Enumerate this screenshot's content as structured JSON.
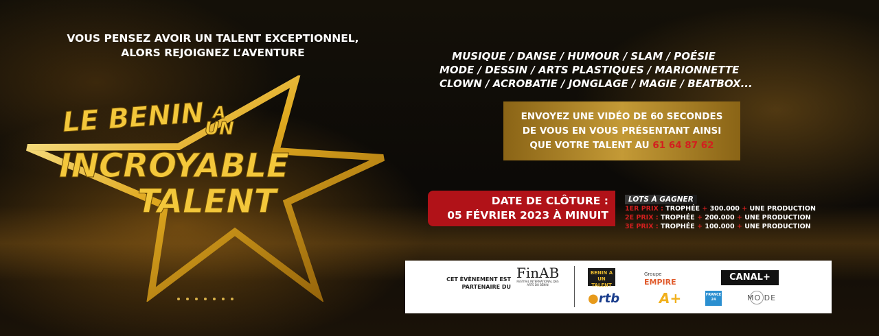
{
  "headline": {
    "line1": "VOUS PENSEZ AVOIR UN TALENT EXCEPTIONNEL,",
    "line2": "ALORS REJOIGNEZ L’AVENTURE"
  },
  "logo": {
    "word1": "LE BENIN",
    "word2": "A",
    "word3": "UN",
    "word4": "INCROYABLE",
    "word5": "TALENT"
  },
  "categories": [
    "MUSIQUE / DANSE / HUMOUR / SLAM / POÉSIE",
    "MODE / DESSIN / ARTS PLASTIQUES / MARIONNETTE",
    "CLOWN / ACROBATIE  / JONGLAGE / MAGIE / BEATBOX..."
  ],
  "video_box": {
    "line1": "ENVOYEZ UNE VIDÉO DE 60 SECONDES",
    "line2": "DE VOUS EN VOUS PRÉSENTANT AINSI",
    "line3_prefix": "QUE VOTRE TALENT AU ",
    "phone": "61 64 87 62"
  },
  "closing": {
    "line1": "DATE DE CLÔTURE :",
    "line2": "05 FÉVRIER 2023 À MINUIT"
  },
  "prizes": {
    "title": "LOTS À GAGNER",
    "items": [
      {
        "rank": "1ER PRIX :",
        "trophy": "TROPHÉE",
        "amount": "300.000",
        "extra": "UNE PRODUCTION"
      },
      {
        "rank": "2E PRIX :",
        "trophy": "TROPHÉE",
        "amount": "200.000",
        "extra": "UNE PRODUCTION"
      },
      {
        "rank": "3E PRIX :",
        "trophy": "TROPHÉE",
        "amount": "100.000",
        "extra": "UNE PRODUCTION"
      }
    ],
    "separator": "+"
  },
  "carousel": {
    "dots": 7
  },
  "partners": {
    "intro_line1": "CET ÉVÈNEMENT EST",
    "intro_line2": "PARTENAIRE DU",
    "finab_name": "FinAB",
    "finab_sub": "FESTIVAL INTERNATIONAL DES ARTS DU BÉNIN",
    "benin_logo": "BENIN A UN TALENT",
    "empire_top": "Groupe",
    "empire_name": "EMPIRE",
    "canal": "CANAL+",
    "ortb": "rtb",
    "a_plus": "A+",
    "france24": "FRANCE 24",
    "mode": "MO  DE"
  },
  "colors": {
    "gold": "#f3c73b",
    "red": "#b11218",
    "accent_red_text": "#d31f1f"
  }
}
